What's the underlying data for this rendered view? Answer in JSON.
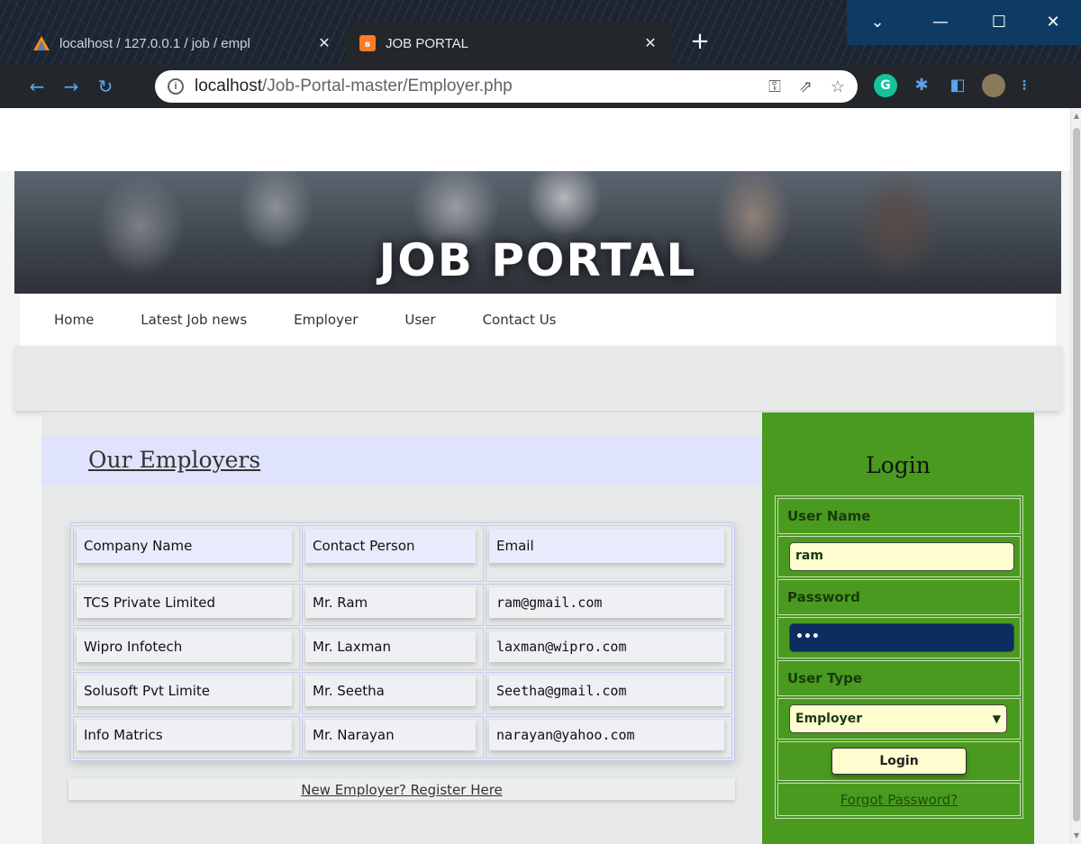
{
  "browser": {
    "tabs": [
      {
        "title": "localhost / 127.0.0.1 / job / empl",
        "active": false
      },
      {
        "title": "JOB PORTAL",
        "active": true
      }
    ],
    "url_host": "localhost",
    "url_path": "/Job-Portal-master/Employer.php",
    "new_tab_label": "+",
    "close_glyph": "✕"
  },
  "banner": {
    "title": "JOB PORTAL"
  },
  "menu": {
    "items": [
      "Home",
      "Latest Job news",
      "Employer",
      "User",
      "Contact Us"
    ]
  },
  "employers": {
    "section_title": "Our Employers",
    "columns": [
      "Company Name",
      "Contact Person",
      "Email"
    ],
    "rows": [
      [
        "TCS Private Limited",
        "Mr. Ram",
        "ram@gmail.com"
      ],
      [
        "Wipro Infotech",
        "Mr. Laxman",
        "laxman@wipro.com"
      ],
      [
        "Solusoft Pvt Limite",
        "Mr. Seetha",
        "Seetha@gmail.com"
      ],
      [
        "Info Matrics",
        "Mr. Narayan",
        "narayan@yahoo.com"
      ]
    ],
    "register_link": "New Employer? Register Here"
  },
  "login": {
    "title": "Login",
    "username_label": "User Name",
    "username_value": "ram",
    "password_label": "Password",
    "password_value": "•••",
    "usertype_label": "User Type",
    "usertype_value": "Employer",
    "submit_label": "Login",
    "forgot_label": "Forgot Password?"
  },
  "colors": {
    "login_panel": "#4a9a1f",
    "section_head": "#dfe3fb",
    "input_yellow": "#fffdd0",
    "input_focus": "#0c2d60"
  }
}
